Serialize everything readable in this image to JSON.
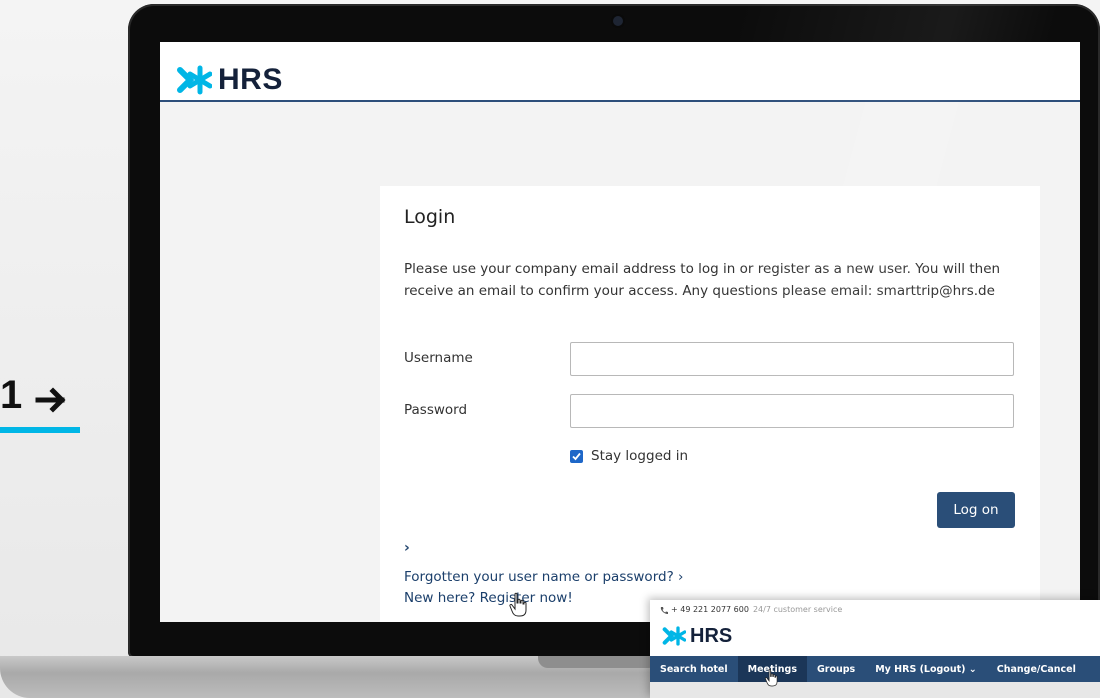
{
  "step": {
    "number": "1",
    "arrow_icon": "arrow-right-icon",
    "underline_color": "#00b6e6"
  },
  "brand": {
    "name": "HRS",
    "accent": "#00b6e6",
    "navy": "#14213a",
    "primary_button": "#2a4e78"
  },
  "login": {
    "title": "Login",
    "intro": "Please use your company email address to log in or register as a new user. You will then receive an email to confirm your access. Any questions please email: smarttrip@hrs.de",
    "username_label": "Username",
    "username_value": "",
    "password_label": "Password",
    "password_value": "",
    "stay_logged_in_label": "Stay logged in",
    "stay_logged_in_checked": true,
    "logon_button": "Log on",
    "chevron": "›",
    "forgot_link": "Forgotten your user name or password? ›",
    "register_link": "New here? Register now!"
  },
  "sub_screenshot": {
    "phone": "+ 49  221 2077 600",
    "phone_note": "24/7 customer service",
    "brand": "HRS",
    "nav": [
      {
        "label": "Search hotel",
        "active": false
      },
      {
        "label": "Meetings",
        "active": true
      },
      {
        "label": "Groups",
        "active": false
      },
      {
        "label": "My HRS (Logout) ⌄",
        "active": false
      },
      {
        "label": "Change/Cancel",
        "active": false
      }
    ]
  }
}
